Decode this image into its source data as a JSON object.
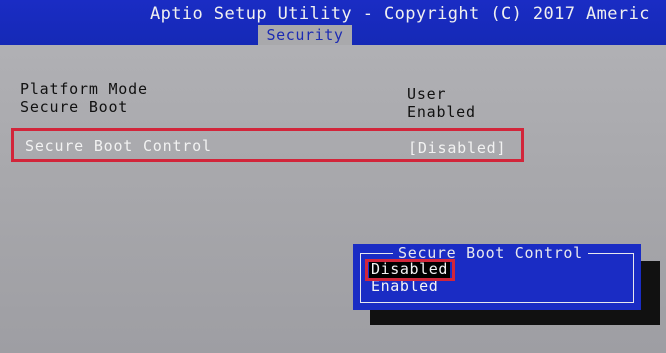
{
  "header": {
    "title": "Aptio Setup Utility - Copyright (C) 2017 Americ",
    "active_tab": "Security"
  },
  "settings": [
    {
      "label": "Platform Mode",
      "value": "User"
    },
    {
      "label": "Secure Boot",
      "value": "Enabled"
    }
  ],
  "selected_setting": {
    "label": "Secure Boot Control",
    "value": "[Disabled]"
  },
  "popup": {
    "title": "Secure Boot Control",
    "options": [
      "Disabled",
      "Enabled"
    ],
    "selected": "Disabled"
  },
  "colors": {
    "bios_blue": "#1a2cc4",
    "background_gray": "#a9a9ac",
    "highlight_red": "#d2253a"
  }
}
